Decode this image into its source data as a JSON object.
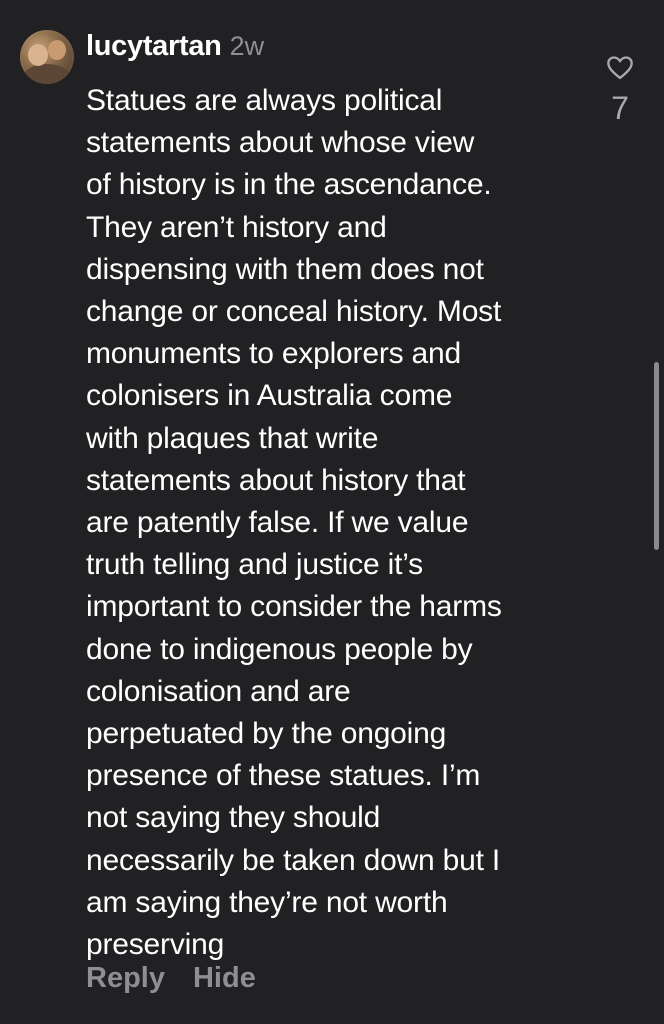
{
  "comment": {
    "username": "lucytartan",
    "time": "2w",
    "avatar_icon": "user-avatar-photo",
    "text_lines": [
      "Statues are always political",
      "statements about whose view",
      "of history is in the ascendance.",
      "They aren’t history and",
      "dispensing with them does not",
      "change or conceal history. Most",
      "monuments to explorers and",
      "colonisers in Australia come",
      "with plaques that write",
      "statements about history that",
      "are patently false. If we value",
      "truth telling and justice it’s",
      "important to consider the harms",
      "done to indigenous people by",
      "colonisation and are",
      "perpetuated by the ongoing",
      "presence of these statues. I’m",
      "not saying they should",
      "necessarily be taken down but I",
      "am saying they’re not worth",
      "preserving"
    ],
    "like_icon": "heart-outline-icon",
    "like_count": "7",
    "actions": {
      "reply": "Reply",
      "hide": "Hide"
    }
  },
  "colors": {
    "background": "#212124",
    "text": "#ffffff",
    "muted": "#8e8e93"
  }
}
